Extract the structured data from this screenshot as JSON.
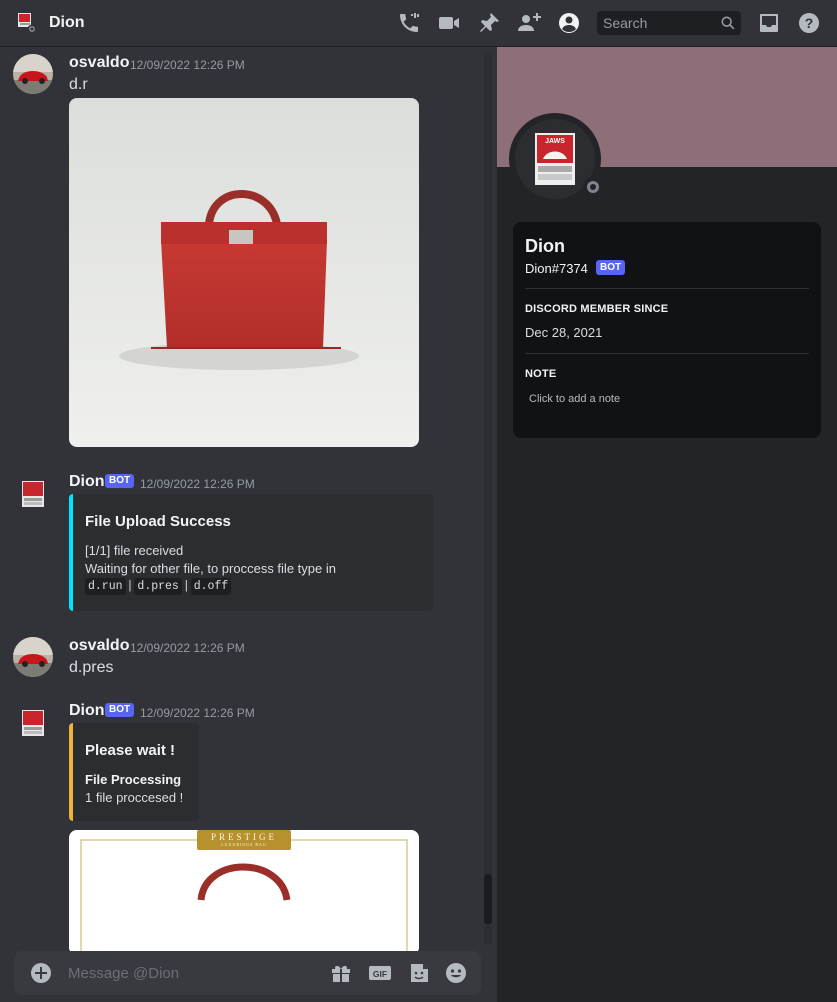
{
  "header": {
    "title": "Dion",
    "search_placeholder": "Search"
  },
  "messages": [
    {
      "author": "osvaldo",
      "timestamp": "12/09/2022 12:26 PM",
      "text": "d.r"
    },
    {
      "author": "Dion",
      "bot_tag": "BOT",
      "timestamp": "12/09/2022 12:26 PM",
      "embed": {
        "color": "#00e5ff",
        "title": "File Upload Success",
        "lines": [
          "[1/1] file received",
          "Waiting for other file, to proccess file type in"
        ],
        "code": [
          "d.run",
          "d.pres",
          "d.off"
        ],
        "sep": "|"
      }
    },
    {
      "author": "osvaldo",
      "timestamp": "12/09/2022 12:26 PM",
      "text": "d.pres"
    },
    {
      "author": "Dion",
      "bot_tag": "BOT",
      "timestamp": "12/09/2022 12:26 PM",
      "embed": {
        "color": "#f0b232",
        "title": "Please wait !",
        "field_name": "File Processing",
        "field_value": "1 file proccesed !"
      },
      "attachment_banner": "PRESTIGE",
      "attachment_banner_sub": "LUXURIOUS BAG"
    }
  ],
  "composer": {
    "placeholder": "Message @Dion"
  },
  "profile": {
    "name": "Dion",
    "tag": "Dion#7374",
    "bot_tag": "BOT",
    "member_since_label": "DISCORD MEMBER SINCE",
    "member_since": "Dec 28, 2021",
    "note_label": "NOTE",
    "note_placeholder": "Click to add a note",
    "avatar_text": "JAWS",
    "banner_color": "#8e6e78"
  },
  "icons": [
    "phone-icon",
    "video-icon",
    "pin-icon",
    "add-friend-icon",
    "profile-toggle-icon",
    "search-icon",
    "inbox-icon",
    "help-icon",
    "add-attachment-icon",
    "gift-icon",
    "gif-icon",
    "sticker-icon",
    "emoji-icon"
  ]
}
